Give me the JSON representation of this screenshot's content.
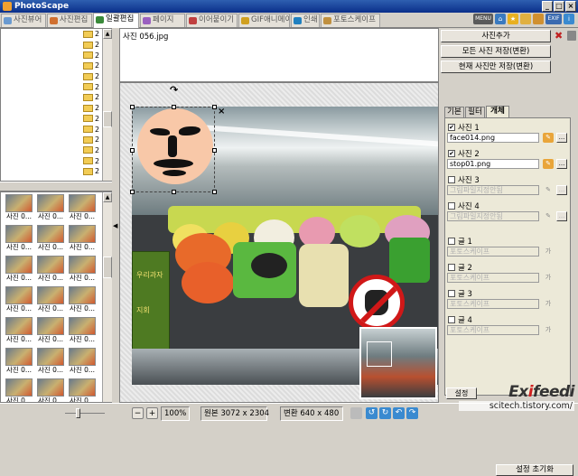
{
  "window": {
    "title": "PhotoScape"
  },
  "tabs": [
    {
      "label": "사진뷰어",
      "color": "#6a9ad0"
    },
    {
      "label": "사진편집",
      "color": "#d07030"
    },
    {
      "label": "일괄편집",
      "color": "#3a8a3a"
    },
    {
      "label": "페이지",
      "color": "#9a60c0"
    },
    {
      "label": "이어붙이기",
      "color": "#c04040"
    },
    {
      "label": "GIF애니메이션",
      "color": "#d0a020"
    },
    {
      "label": "인쇄",
      "color": "#2080c0"
    },
    {
      "label": "포토스케이프",
      "color": "#c09040"
    }
  ],
  "toolbar_icons": [
    "menu-icon",
    "home-icon",
    "star-icon",
    "folder-icon",
    "folder-open-icon",
    "exif-icon",
    "info-icon"
  ],
  "toolbar": {
    "menu_label": "MENU",
    "exif_label": "EXIF"
  },
  "tree": {
    "items": [
      "2",
      "2",
      "2",
      "2",
      "2",
      "2",
      "2",
      "2",
      "2",
      "2",
      "2",
      "2",
      "2",
      "2"
    ]
  },
  "thumbnails": {
    "items": [
      "사진 0...",
      "사진 0...",
      "사진 0...",
      "사진 0...",
      "사진 0...",
      "사진 0...",
      "사진 0...",
      "사진 0...",
      "사진 0...",
      "사진 0...",
      "사진 0...",
      "사진 0...",
      "사진 0...",
      "사진 0...",
      "사진 0...",
      "사진 0...",
      "사진 0...",
      "사진 0...",
      "사진 0...",
      "사진 0...",
      "사진 0..."
    ]
  },
  "editor": {
    "filename": "사진 056.jpg",
    "photo_sign": "우리과자",
    "photo_sign2": "지회"
  },
  "status": {
    "zoom": "100%",
    "original": "원본 3072 x 2304",
    "converted": "변환 640 x 480"
  },
  "right_panel": {
    "add_photo": "사진추가",
    "save_all": "모든 사진 저장(변환)",
    "save_current": "현재 사진만 저장(변환)",
    "subtabs": [
      "기본",
      "필터",
      "개체"
    ],
    "active_subtab": "개체",
    "photos": [
      {
        "label": "사진 1",
        "checked": true,
        "value": "face014.png",
        "enabled": true
      },
      {
        "label": "사진 2",
        "checked": true,
        "value": "stop01.png",
        "enabled": true
      },
      {
        "label": "사진 3",
        "checked": false,
        "value": "그림파일지정안됨",
        "enabled": false
      },
      {
        "label": "사진 4",
        "checked": false,
        "value": "그림파일지정안됨",
        "enabled": false
      }
    ],
    "texts": [
      {
        "label": "글 1",
        "checked": false,
        "value": "포토스케이프"
      },
      {
        "label": "글 2",
        "checked": false,
        "value": "포토스케이프"
      },
      {
        "label": "글 3",
        "checked": false,
        "value": "포토스케이프"
      },
      {
        "label": "글 4",
        "checked": false,
        "value": "포토스케이프"
      }
    ],
    "reset_settings": "설정 초기화",
    "settings": "설정"
  },
  "watermark": {
    "brand_prefix": "Ex",
    "brand_suffix": "feedi",
    "url": "scitech.tistory.com/"
  }
}
